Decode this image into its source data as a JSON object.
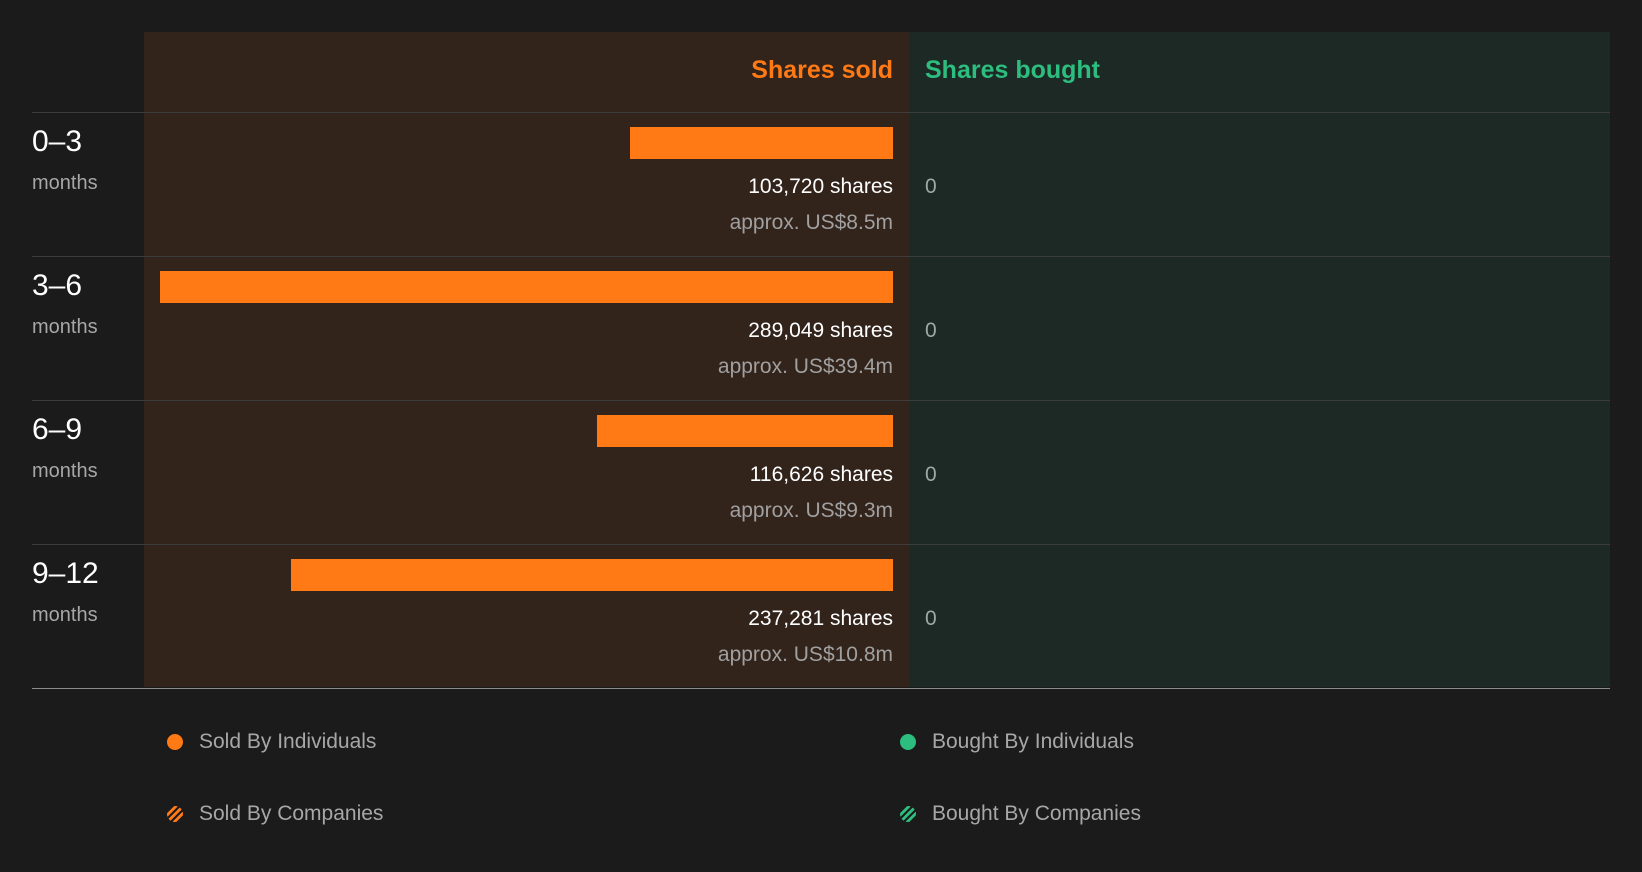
{
  "headers": {
    "sold": "Shares sold",
    "bought": "Shares bought"
  },
  "chart_data": {
    "type": "bar",
    "categories": [
      "0-3",
      "3-6",
      "6-9",
      "9-12"
    ],
    "unit_label": "months",
    "series": [
      {
        "name": "Shares sold",
        "values": [
          103720,
          289049,
          116626,
          237281
        ],
        "labels": [
          "103,720 shares",
          "289,049 shares",
          "116,626 shares",
          "237,281 shares"
        ],
        "value_labels": [
          "approx. US$8.5m",
          "approx. US$39.4m",
          "approx. US$9.3m",
          "approx. US$10.8m"
        ],
        "color": "#ff7a15"
      },
      {
        "name": "Shares bought",
        "values": [
          0,
          0,
          0,
          0
        ],
        "labels": [
          "0",
          "0",
          "0",
          "0"
        ],
        "color": "#2dbd7e"
      }
    ]
  },
  "legend": [
    {
      "label": "Sold By Individuals",
      "color": "#ff7a15",
      "style": "solid"
    },
    {
      "label": "Bought By Individuals",
      "color": "#2dbd7e",
      "style": "solid"
    },
    {
      "label": "Sold By Companies",
      "color": "#ff7a15",
      "style": "striped"
    },
    {
      "label": "Bought By Companies",
      "color": "#2dbd7e",
      "style": "striped"
    }
  ]
}
